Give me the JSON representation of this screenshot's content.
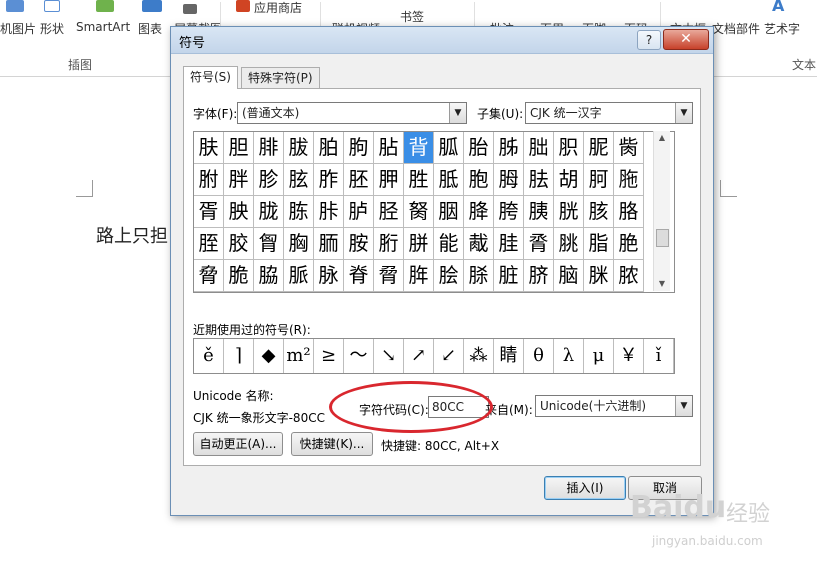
{
  "ribbon": {
    "items": [
      "机图片",
      "形状",
      "SmartArt",
      "图表",
      "屏幕截图",
      "应用商店",
      "联机视频",
      "书签",
      "批注",
      "页眉",
      "页脚",
      "页码",
      "文本框",
      "文档部件",
      "艺术字"
    ],
    "group_insert": "插图",
    "group_text": "文本",
    "accent_color": "#d04423"
  },
  "document": {
    "text": "路上只担"
  },
  "dialog": {
    "title": "符号",
    "help": "?",
    "close": "✕",
    "tabs": {
      "symbols": "符号(S)",
      "special": "特殊字符(P)"
    },
    "font_label": "字体(F):",
    "font_value": "(普通文本)",
    "subset_label": "子集(U):",
    "subset_value": "CJK 统一汉字",
    "grid": [
      [
        "肤",
        "胆",
        "腓",
        "胈",
        "胉",
        "朐",
        "胋",
        "背",
        "胍",
        "胎",
        "胏",
        "朏",
        "胑",
        "胒",
        "胔"
      ],
      [
        "胕",
        "胖",
        "胗",
        "胘",
        "胙",
        "胚",
        "胛",
        "胜",
        "胝",
        "胞",
        "胟",
        "胠",
        "胡",
        "胢",
        "胣"
      ],
      [
        "胥",
        "胦",
        "胧",
        "胨",
        "胩",
        "胪",
        "胫",
        "胬",
        "胭",
        "胮",
        "胯",
        "胰",
        "胱",
        "胲",
        "胳"
      ],
      [
        "胵",
        "胶",
        "胷",
        "胸",
        "胹",
        "胺",
        "胻",
        "胼",
        "能",
        "胾",
        "胿",
        "脀",
        "脁",
        "脂",
        "脃"
      ],
      [
        "脅",
        "脆",
        "脇",
        "脈",
        "脉",
        "脊",
        "脋",
        "脌",
        "脍",
        "脎",
        "脏",
        "脐",
        "脑",
        "脒",
        "脓"
      ]
    ],
    "selected_symbol": "背",
    "recent_label": "近期使用过的符号(R):",
    "recent": [
      "ě",
      "⌉",
      "◆",
      "m²",
      "≥",
      "～",
      "↘",
      "↗",
      "↙",
      "⁂",
      "睛",
      "θ",
      "λ",
      "μ",
      "￥",
      "ǐ"
    ],
    "unicode_name_label": "Unicode 名称:",
    "unicode_name_value": "CJK 统一象形文字-80CC",
    "char_code_label": "字符代码(C):",
    "char_code_value": "80CC",
    "from_label": "来自(M):",
    "from_value": "Unicode(十六进制)",
    "autocorrect_button": "自动更正(A)...",
    "shortcut_button": "快捷键(K)...",
    "shortcut_text": "快捷键: 80CC, Alt+X",
    "insert_button": "插入(I)",
    "cancel_button": "取消",
    "annotation_color": "#d9272e"
  },
  "watermark": {
    "brand": "Baidu",
    "text": "经验",
    "url": "jingyan.baidu.com"
  }
}
